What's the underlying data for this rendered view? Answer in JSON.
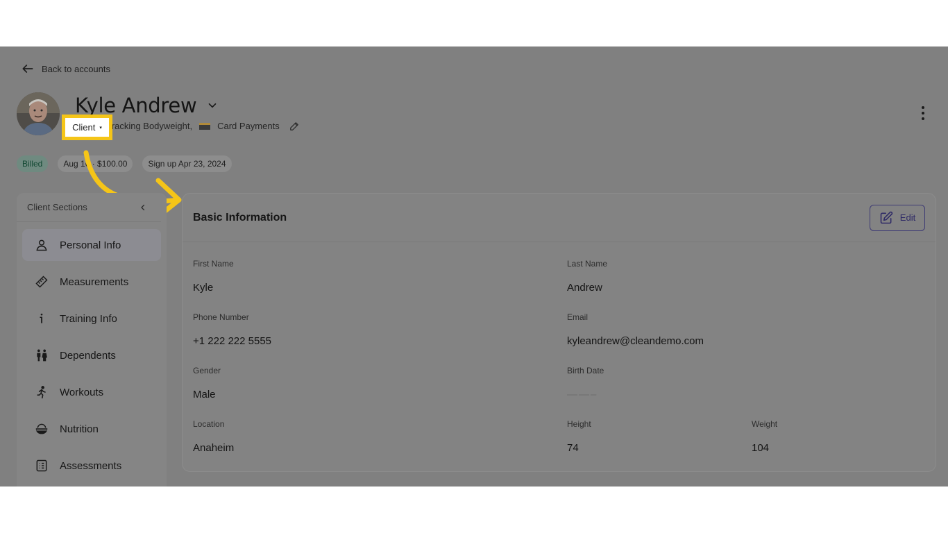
{
  "nav": {
    "back_label": "Back to accounts"
  },
  "profile": {
    "name": "Kyle Andrew",
    "type_chip": "Client",
    "tags_text": "racking Bodyweight,",
    "payment_tag": "Card Payments"
  },
  "badges": {
    "billed": "Billed",
    "billing": "Aug 16 · $100.00",
    "signup": "Sign up Apr 23, 2024"
  },
  "sidebar": {
    "title": "Client Sections",
    "items": [
      {
        "label": "Personal Info",
        "icon": "person-icon"
      },
      {
        "label": "Measurements",
        "icon": "ruler-icon"
      },
      {
        "label": "Training Info",
        "icon": "info-icon"
      },
      {
        "label": "Dependents",
        "icon": "family-icon"
      },
      {
        "label": "Workouts",
        "icon": "running-icon"
      },
      {
        "label": "Nutrition",
        "icon": "bowl-icon"
      },
      {
        "label": "Assessments",
        "icon": "checklist-icon"
      }
    ]
  },
  "panel": {
    "title": "Basic Information",
    "edit_label": "Edit",
    "fields": {
      "first_name": {
        "label": "First Name",
        "value": "Kyle"
      },
      "last_name": {
        "label": "Last Name",
        "value": "Andrew"
      },
      "phone": {
        "label": "Phone Number",
        "value": "+1 222 222 5555"
      },
      "email": {
        "label": "Email",
        "value": "kyleandrew@cleandemo.com"
      },
      "gender": {
        "label": "Gender",
        "value": "Male"
      },
      "birth_date": {
        "label": "Birth Date",
        "value": "——–"
      },
      "location": {
        "label": "Location",
        "value": "Anaheim"
      },
      "height": {
        "label": "Height",
        "value": "74"
      },
      "weight": {
        "label": "Weight",
        "value": "104"
      }
    }
  },
  "colors": {
    "overlay": "#808080",
    "highlight": "#f5c518",
    "edit_accent": "#2e2a66",
    "billed": "#124832"
  }
}
